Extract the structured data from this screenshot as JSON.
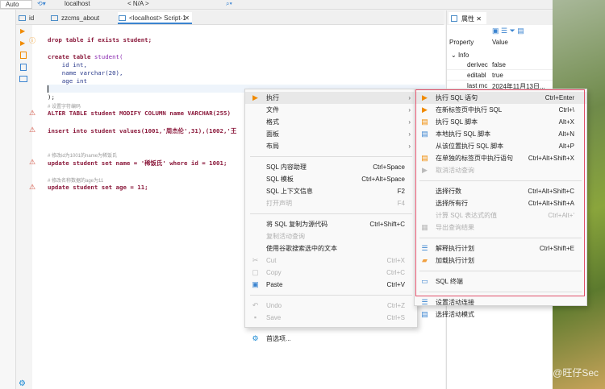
{
  "toolbar": {
    "mode": "Auto",
    "connection": "localhost",
    "schema": "< N/A >"
  },
  "tabs": [
    {
      "label": "id"
    },
    {
      "label": "zzcms_about"
    },
    {
      "label": "<localhost> Script-1"
    }
  ],
  "editor": {
    "lines": {
      "l1": "drop table if exists student;",
      "l2a": "create table ",
      "l2b": "student(",
      "l3": "    id int,",
      "l4": "    name varchar(20),",
      "l5": "    age int",
      "l6": ");",
      "c1": "# 设置字符编码",
      "l7": "ALTER TABLE student MODIFY COLUMN name VARCHAR(255)",
      "l8": "insert into student values(1001,'周杰伦',31),(1002,'王",
      "c2": "# 修改id为1001的name为稀饭氏",
      "l9": "update student set name = '稀饭氏' where id = 1001;",
      "c3": "# 修改名称数据的age为11",
      "l10": "update student set age = 11;"
    }
  },
  "properties": {
    "tab": "属性",
    "col_property": "Property",
    "col_value": "Value",
    "group": "Info",
    "rows": [
      {
        "name": "derivec",
        "value": "false"
      },
      {
        "name": "editabl",
        "value": "true"
      },
      {
        "name": "last mc",
        "value": "2024年11月13日..."
      }
    ]
  },
  "context_menu": [
    {
      "label": "执行",
      "submenu": true,
      "icon": "play",
      "highlight": true
    },
    {
      "label": "文件",
      "submenu": true
    },
    {
      "label": "格式",
      "submenu": true
    },
    {
      "label": "面板",
      "submenu": true
    },
    {
      "label": "布局",
      "submenu": true
    },
    {
      "sep": true
    },
    {
      "label": "SQL 内容助理",
      "shortcut": "Ctrl+Space"
    },
    {
      "label": "SQL 模板",
      "shortcut": "Ctrl+Alt+Space"
    },
    {
      "label": "SQL 上下文信息",
      "shortcut": "F2"
    },
    {
      "label": "打开声明",
      "shortcut": "F4",
      "disabled": true
    },
    {
      "sep": true
    },
    {
      "label": "将 SQL 复制为源代码",
      "shortcut": "Ctrl+Shift+C"
    },
    {
      "label": "复制活动查询",
      "disabled": true
    },
    {
      "label": "使用谷歌搜索选中的文本"
    },
    {
      "label": "Cut",
      "shortcut": "Ctrl+X",
      "disabled": true,
      "icon": "cut"
    },
    {
      "label": "Copy",
      "shortcut": "Ctrl+C",
      "disabled": true,
      "icon": "copy"
    },
    {
      "label": "Paste",
      "shortcut": "Ctrl+V",
      "icon": "paste"
    },
    {
      "sep": true
    },
    {
      "label": "Undo",
      "shortcut": "Ctrl+Z",
      "disabled": true,
      "icon": "undo"
    },
    {
      "label": "Save",
      "shortcut": "Ctrl+S",
      "disabled": true,
      "icon": "save"
    },
    {
      "sep": true
    },
    {
      "label": "首选项...",
      "icon": "gear"
    }
  ],
  "execute_submenu": [
    {
      "label": "执行 SQL 语句",
      "shortcut": "Ctrl+Enter",
      "icon": "play",
      "highlight": true
    },
    {
      "label": "在新标签页中执行 SQL",
      "shortcut": "Ctrl+\\",
      "icon": "play-new-tab"
    },
    {
      "label": "执行 SQL 脚本",
      "shortcut": "Alt+X",
      "icon": "script"
    },
    {
      "label": "本地执行 SQL 脚本",
      "shortcut": "Alt+N",
      "icon": "script-local"
    },
    {
      "label": "从该位置执行 SQL 脚本",
      "shortcut": "Alt+P"
    },
    {
      "label": "在单独的标签页中执行语句",
      "shortcut": "Ctrl+Alt+Shift+X",
      "icon": "script-tabs"
    },
    {
      "label": "取消活动查询",
      "disabled": true,
      "icon": "cancel"
    },
    {
      "sep": true
    },
    {
      "label": "选择行数",
      "shortcut": "Ctrl+Alt+Shift+C"
    },
    {
      "label": "选择所有行",
      "shortcut": "Ctrl+Alt+Shift+A"
    },
    {
      "label": "计算 SQL 表达式的值",
      "shortcut": "Ctrl+Alt+'",
      "disabled": true
    },
    {
      "label": "导出查询结果",
      "disabled": true,
      "icon": "export"
    },
    {
      "sep": true
    },
    {
      "label": "解释执行计划",
      "shortcut": "Ctrl+Shift+E",
      "icon": "plan"
    },
    {
      "label": "加载执行计划",
      "icon": "folder"
    },
    {
      "sep": true
    },
    {
      "label": "SQL 终端",
      "icon": "terminal"
    },
    {
      "sep": true
    },
    {
      "label": "设置活动连接",
      "icon": "database"
    },
    {
      "label": "选择活动模式",
      "icon": "schema"
    }
  ],
  "watermark": "CSDN @旺仔Sec"
}
